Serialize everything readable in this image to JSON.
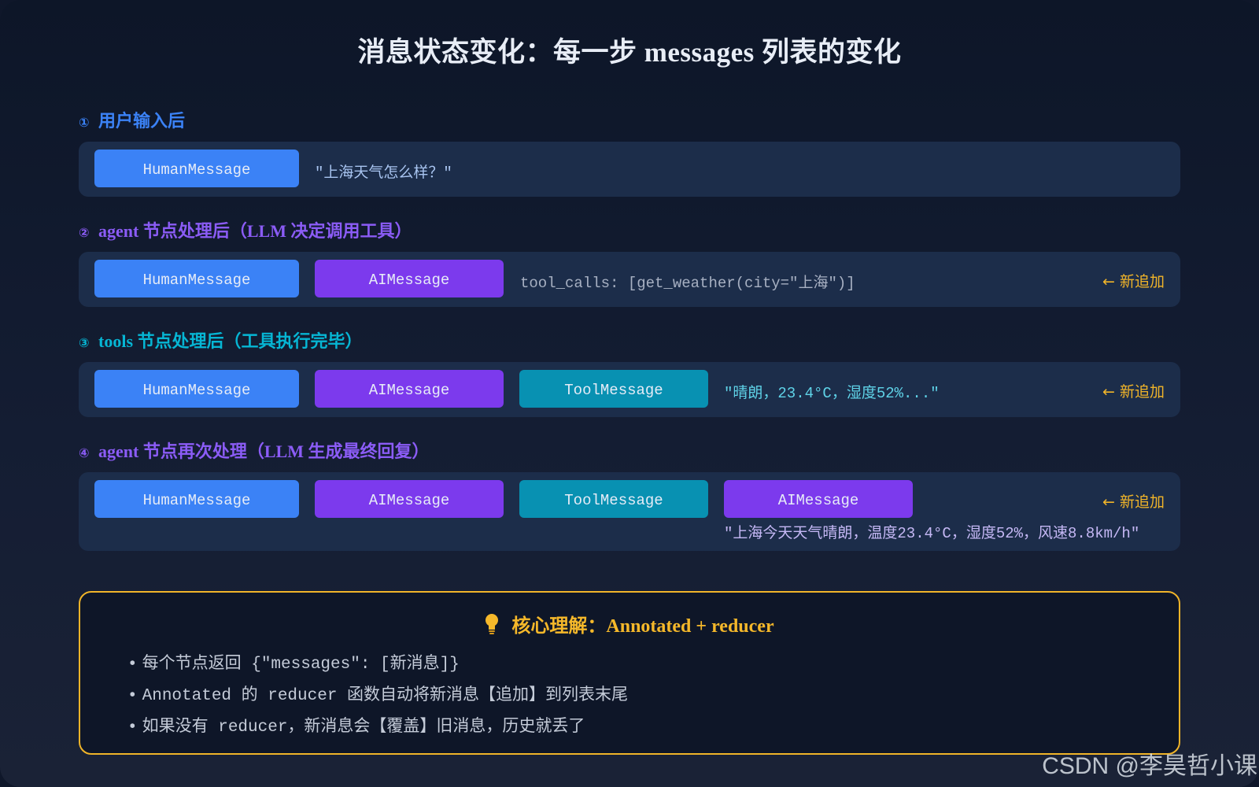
{
  "title": "消息状态变化：每一步 messages 列表的变化",
  "steps": [
    {
      "num": "①",
      "label": "用户输入后",
      "color": "#3b82f6",
      "messages": [
        "HumanMessage"
      ],
      "note": "\"上海天气怎么样？\"",
      "note_color": "#a8c4f0",
      "new_tag": ""
    },
    {
      "num": "②",
      "label": "agent 节点处理后（LLM 决定调用工具）",
      "color": "#8b5cf6",
      "messages": [
        "HumanMessage",
        "AIMessage"
      ],
      "note": "tool_calls: [get_weather(city=\"上海\")]",
      "note_color": "#a7b0c2",
      "new_tag": "← 新追加"
    },
    {
      "num": "③",
      "label": "tools 节点处理后（工具执行完毕）",
      "color": "#06b6d4",
      "messages": [
        "HumanMessage",
        "AIMessage",
        "ToolMessage"
      ],
      "note": "\"晴朗，23.4°C，湿度52%...\"",
      "note_color": "#5fd3e8",
      "new_tag": "← 新追加"
    },
    {
      "num": "④",
      "label": "agent 节点再次处理（LLM 生成最终回复）",
      "color": "#8b5cf6",
      "messages": [
        "HumanMessage",
        "AIMessage",
        "ToolMessage",
        "AIMessage"
      ],
      "note": "\"上海今天天气晴朗，温度23.4°C，湿度52%，风速8.8km/h\"",
      "note_color": "#c5b8f5",
      "new_tag": "← 新追加"
    }
  ],
  "core": {
    "title": "核心理解：Annotated + reducer",
    "bullets": [
      "每个节点返回 {\"messages\": [新消息]}",
      "Annotated 的 reducer 函数自动将新消息【追加】到列表末尾",
      "如果没有 reducer，新消息会【覆盖】旧消息，历史就丢了"
    ]
  },
  "watermark": "CSDN @李昊哲小课",
  "colors": {
    "human": "#3b82f6",
    "ai": "#7c3aed",
    "tool": "#0891b2",
    "accent": "#f0b429"
  },
  "icons": {
    "core_title": "lightbulb-icon"
  }
}
